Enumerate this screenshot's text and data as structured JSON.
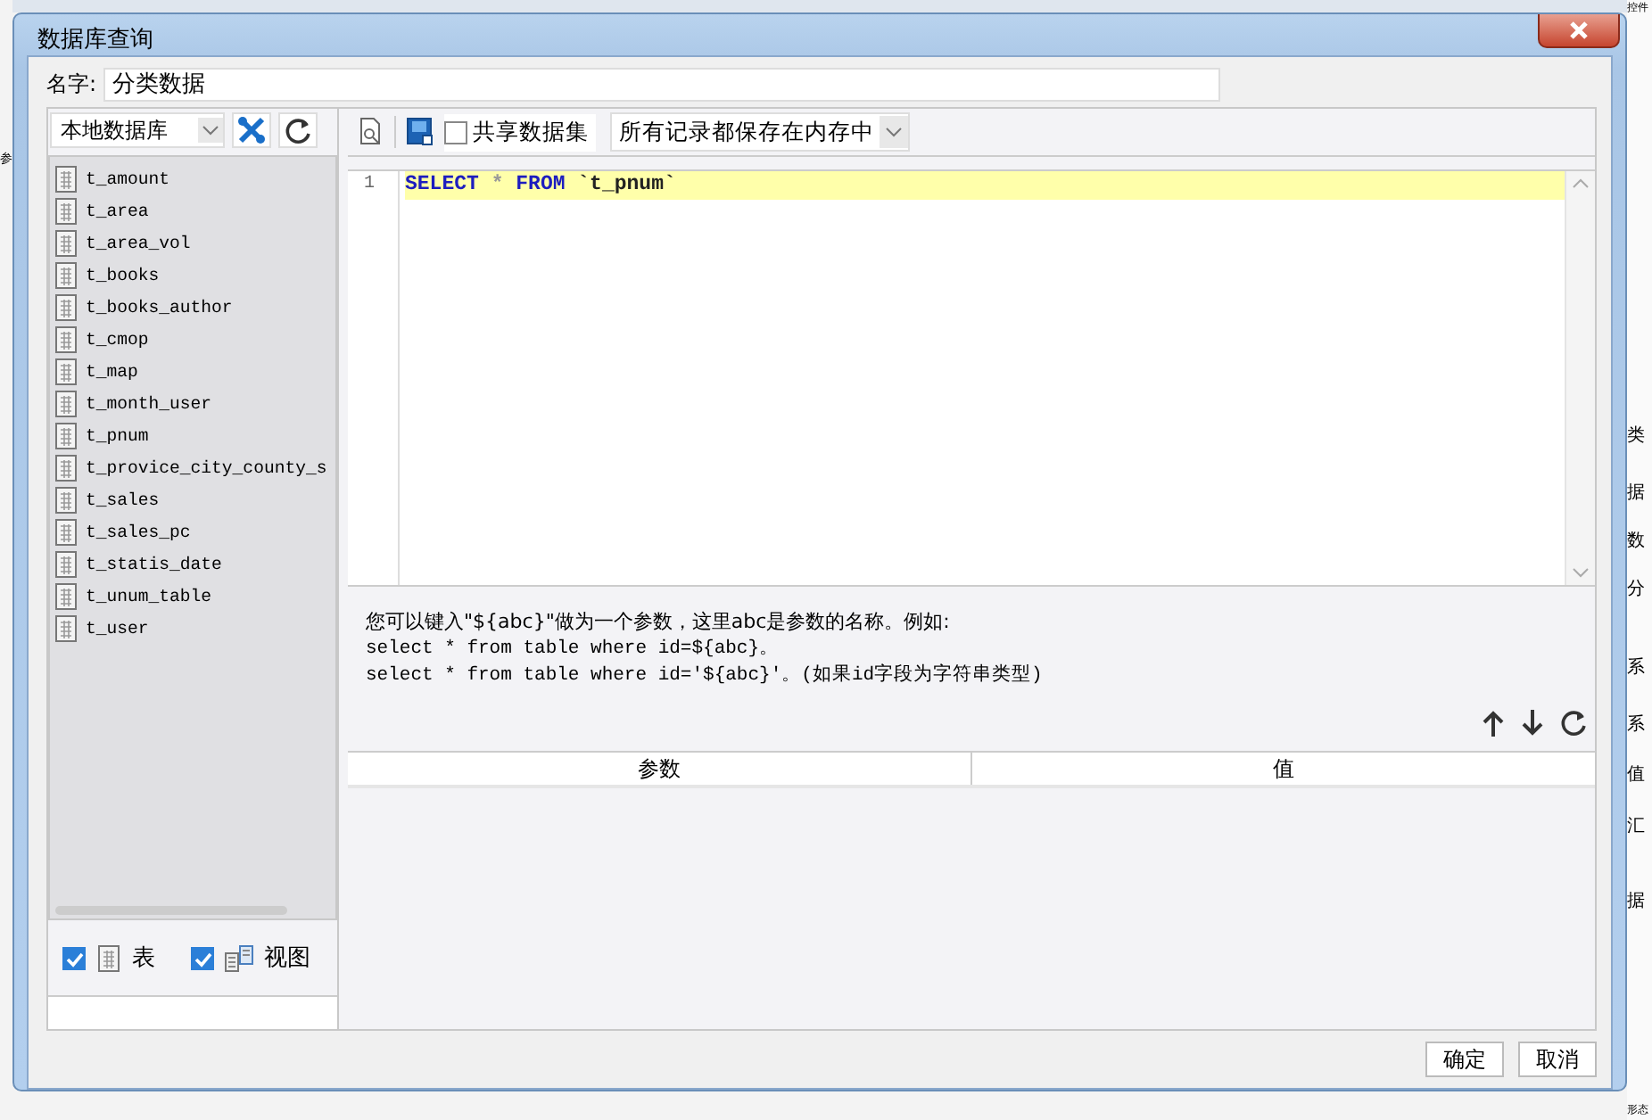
{
  "window": {
    "title": "数据库查询"
  },
  "name_field": {
    "label": "名字:",
    "value": "分类数据"
  },
  "source": {
    "value": "本地数据库"
  },
  "tables": [
    "t_amount",
    "t_area",
    "t_area_vol",
    "t_books",
    "t_books_author",
    "t_cmop",
    "t_map",
    "t_month_user",
    "t_pnum",
    "t_provice_city_county_s",
    "t_sales",
    "t_sales_pc",
    "t_statis_date",
    "t_unum_table",
    "t_user"
  ],
  "filters": [
    {
      "label": "表",
      "checked": true,
      "kind": "table"
    },
    {
      "label": "视图",
      "checked": true,
      "kind": "view"
    }
  ],
  "toolbar": {
    "share": {
      "label": "共享数据集",
      "checked": false
    },
    "storage": {
      "value": "所有记录都保存在内存中"
    }
  },
  "editor": {
    "lines": [
      {
        "number": "1",
        "text": "SELECT * FROM `t_pnum`",
        "current": true
      }
    ]
  },
  "hint": {
    "lines": [
      {
        "kind": "prose",
        "text": "您可以键入\"${abc}\"做为一个参数，这里abc是参数的名称。例如:"
      },
      {
        "kind": "code",
        "text": "select * from table where id=${abc}。"
      },
      {
        "kind": "code",
        "text": "select * from table where id='${abc}'。(如果id字段为字符串类型)"
      }
    ]
  },
  "params": {
    "columns": [
      "参数",
      "值"
    ]
  },
  "buttons": [
    "确定",
    "取消"
  ],
  "background": {
    "left_text": [
      "参"
    ],
    "right_text": [
      "控件",
      "类",
      "据",
      "数",
      "分",
      "系",
      "系",
      "值",
      "汇",
      "据",
      "形态"
    ]
  }
}
